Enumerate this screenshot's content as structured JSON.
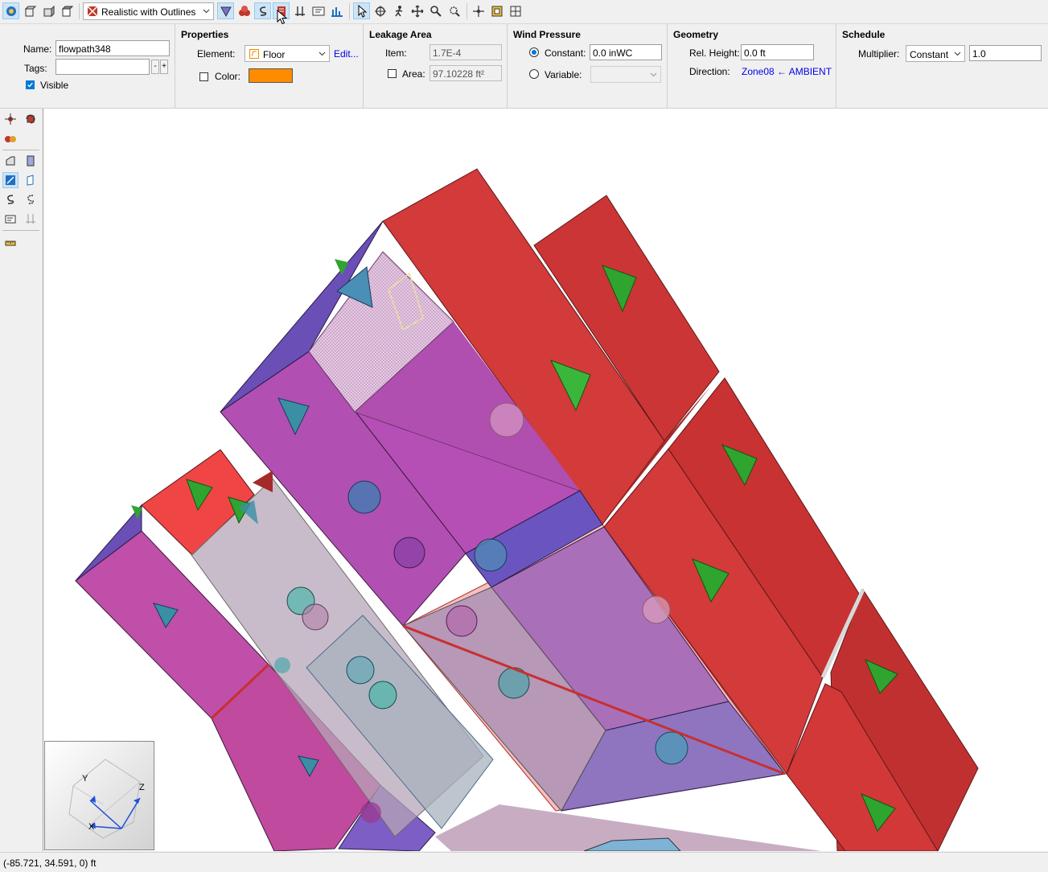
{
  "toolbar": {
    "render_mode": "Realistic with Outlines"
  },
  "properties_panel": {
    "name_label": "Name:",
    "name_value": "flowpath348",
    "tags_label": "Tags:",
    "tags_value": "",
    "tags_minus": "-",
    "tags_plus": "+",
    "visible_label": "Visible",
    "visible_checked": true
  },
  "properties": {
    "title": "Properties",
    "element_label": "Element:",
    "element_value": "Floor",
    "edit_link": "Edit...",
    "color_label": "Color:",
    "color_checked": false,
    "color_swatch": "#ff8c00"
  },
  "leakage_area": {
    "title": "Leakage Area",
    "item_label": "Item:",
    "item_value": "1.7E-4",
    "area_label": "Area:",
    "area_checked": false,
    "area_value": "97.10228 ft²"
  },
  "wind_pressure": {
    "title": "Wind Pressure",
    "constant_label": "Constant:",
    "constant_value": "0.0 inWC",
    "constant_selected": true,
    "variable_label": "Variable:",
    "variable_value": ""
  },
  "geometry": {
    "title": "Geometry",
    "rel_height_label": "Rel. Height:",
    "rel_height_value": "0.0 ft",
    "direction_label": "Direction:",
    "direction_value": "Zone08 ← AMBIENT"
  },
  "schedule": {
    "title": "Schedule",
    "multiplier_label": "Multiplier:",
    "multiplier_type": "Constant",
    "multiplier_value": "1.0"
  },
  "axis_widget": {
    "y_label": "Y",
    "z_label": "Z",
    "x_label": "X"
  },
  "status": {
    "coordinates": "(-85.721, 34.591, 0) ft"
  },
  "colors": {
    "red_wall": "#d33a3a",
    "magenta_wall": "#b24fb3",
    "purple_wall": "#6a4fb6",
    "green_marker": "#2fa52f",
    "teal_marker": "#3a8fa5",
    "selection_blue": "#cce4f7"
  }
}
